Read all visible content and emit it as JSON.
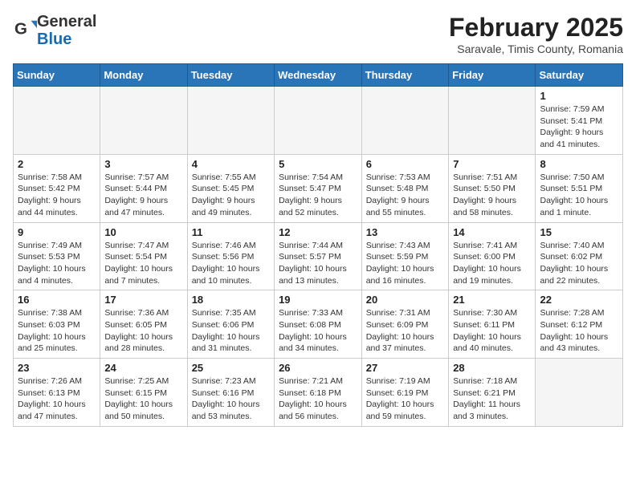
{
  "header": {
    "logo_line1": "General",
    "logo_line2": "Blue",
    "month": "February 2025",
    "location": "Saravale, Timis County, Romania"
  },
  "weekdays": [
    "Sunday",
    "Monday",
    "Tuesday",
    "Wednesday",
    "Thursday",
    "Friday",
    "Saturday"
  ],
  "weeks": [
    [
      {
        "day": "",
        "info": ""
      },
      {
        "day": "",
        "info": ""
      },
      {
        "day": "",
        "info": ""
      },
      {
        "day": "",
        "info": ""
      },
      {
        "day": "",
        "info": ""
      },
      {
        "day": "",
        "info": ""
      },
      {
        "day": "1",
        "info": "Sunrise: 7:59 AM\nSunset: 5:41 PM\nDaylight: 9 hours and 41 minutes."
      }
    ],
    [
      {
        "day": "2",
        "info": "Sunrise: 7:58 AM\nSunset: 5:42 PM\nDaylight: 9 hours and 44 minutes."
      },
      {
        "day": "3",
        "info": "Sunrise: 7:57 AM\nSunset: 5:44 PM\nDaylight: 9 hours and 47 minutes."
      },
      {
        "day": "4",
        "info": "Sunrise: 7:55 AM\nSunset: 5:45 PM\nDaylight: 9 hours and 49 minutes."
      },
      {
        "day": "5",
        "info": "Sunrise: 7:54 AM\nSunset: 5:47 PM\nDaylight: 9 hours and 52 minutes."
      },
      {
        "day": "6",
        "info": "Sunrise: 7:53 AM\nSunset: 5:48 PM\nDaylight: 9 hours and 55 minutes."
      },
      {
        "day": "7",
        "info": "Sunrise: 7:51 AM\nSunset: 5:50 PM\nDaylight: 9 hours and 58 minutes."
      },
      {
        "day": "8",
        "info": "Sunrise: 7:50 AM\nSunset: 5:51 PM\nDaylight: 10 hours and 1 minute."
      }
    ],
    [
      {
        "day": "9",
        "info": "Sunrise: 7:49 AM\nSunset: 5:53 PM\nDaylight: 10 hours and 4 minutes."
      },
      {
        "day": "10",
        "info": "Sunrise: 7:47 AM\nSunset: 5:54 PM\nDaylight: 10 hours and 7 minutes."
      },
      {
        "day": "11",
        "info": "Sunrise: 7:46 AM\nSunset: 5:56 PM\nDaylight: 10 hours and 10 minutes."
      },
      {
        "day": "12",
        "info": "Sunrise: 7:44 AM\nSunset: 5:57 PM\nDaylight: 10 hours and 13 minutes."
      },
      {
        "day": "13",
        "info": "Sunrise: 7:43 AM\nSunset: 5:59 PM\nDaylight: 10 hours and 16 minutes."
      },
      {
        "day": "14",
        "info": "Sunrise: 7:41 AM\nSunset: 6:00 PM\nDaylight: 10 hours and 19 minutes."
      },
      {
        "day": "15",
        "info": "Sunrise: 7:40 AM\nSunset: 6:02 PM\nDaylight: 10 hours and 22 minutes."
      }
    ],
    [
      {
        "day": "16",
        "info": "Sunrise: 7:38 AM\nSunset: 6:03 PM\nDaylight: 10 hours and 25 minutes."
      },
      {
        "day": "17",
        "info": "Sunrise: 7:36 AM\nSunset: 6:05 PM\nDaylight: 10 hours and 28 minutes."
      },
      {
        "day": "18",
        "info": "Sunrise: 7:35 AM\nSunset: 6:06 PM\nDaylight: 10 hours and 31 minutes."
      },
      {
        "day": "19",
        "info": "Sunrise: 7:33 AM\nSunset: 6:08 PM\nDaylight: 10 hours and 34 minutes."
      },
      {
        "day": "20",
        "info": "Sunrise: 7:31 AM\nSunset: 6:09 PM\nDaylight: 10 hours and 37 minutes."
      },
      {
        "day": "21",
        "info": "Sunrise: 7:30 AM\nSunset: 6:11 PM\nDaylight: 10 hours and 40 minutes."
      },
      {
        "day": "22",
        "info": "Sunrise: 7:28 AM\nSunset: 6:12 PM\nDaylight: 10 hours and 43 minutes."
      }
    ],
    [
      {
        "day": "23",
        "info": "Sunrise: 7:26 AM\nSunset: 6:13 PM\nDaylight: 10 hours and 47 minutes."
      },
      {
        "day": "24",
        "info": "Sunrise: 7:25 AM\nSunset: 6:15 PM\nDaylight: 10 hours and 50 minutes."
      },
      {
        "day": "25",
        "info": "Sunrise: 7:23 AM\nSunset: 6:16 PM\nDaylight: 10 hours and 53 minutes."
      },
      {
        "day": "26",
        "info": "Sunrise: 7:21 AM\nSunset: 6:18 PM\nDaylight: 10 hours and 56 minutes."
      },
      {
        "day": "27",
        "info": "Sunrise: 7:19 AM\nSunset: 6:19 PM\nDaylight: 10 hours and 59 minutes."
      },
      {
        "day": "28",
        "info": "Sunrise: 7:18 AM\nSunset: 6:21 PM\nDaylight: 11 hours and 3 minutes."
      },
      {
        "day": "",
        "info": ""
      }
    ]
  ]
}
